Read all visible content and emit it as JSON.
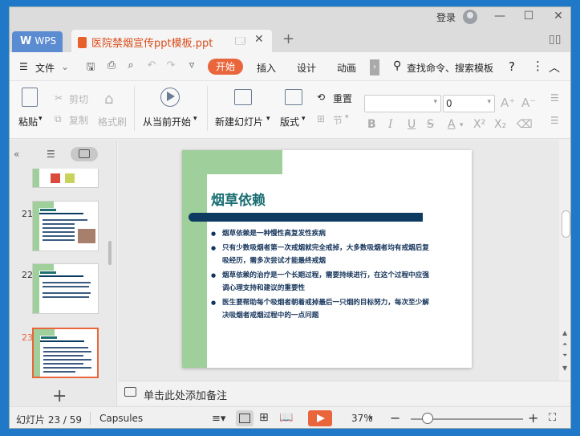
{
  "titlebar": {
    "login": "登录"
  },
  "tabs": {
    "wps": "WPS",
    "wps_logo": "W",
    "document": "医院禁烟宣传ppt模板.ppt"
  },
  "menu": {
    "file": "文件",
    "items": [
      "开始",
      "插入",
      "设计",
      "动画"
    ],
    "search": "查找命令、搜索模板",
    "help": "?"
  },
  "ribbon": {
    "paste": "粘贴",
    "cut": "剪切",
    "copy": "复制",
    "format_painter": "格式刷",
    "play_from_current": "从当前开始",
    "new_slide": "新建幻灯片",
    "layout": "版式",
    "reset": "重置",
    "section": "节",
    "font_size": "0"
  },
  "left_panel": {
    "thumbnails": [
      {
        "number": "21"
      },
      {
        "number": "22"
      },
      {
        "number": "23"
      }
    ],
    "add": "+"
  },
  "slide": {
    "title": "烟草依赖",
    "bullets": [
      "烟草依赖是一种慢性高复发性疾病",
      "只有少数吸烟者第一次戒烟就完全戒掉，大多数吸烟者均有戒烟后复吸经历，需多次尝试才能最终戒烟",
      "烟草依赖的治疗是一个长期过程，需要持续进行，在这个过程中应强调心理支持和建议的重要性",
      "医生要帮助每个吸烟者朝着戒掉最后一只烟的目标努力，每次至少解决吸烟者戒烟过程中的一点问题"
    ]
  },
  "notes": {
    "placeholder": "单击此处添加备注"
  },
  "status": {
    "slide_count": "幻灯片 23 / 59",
    "theme": "Capsules",
    "zoom": "37%",
    "zoom_level": 37
  },
  "colors": {
    "accent": "#e9663c",
    "slide_green": "#9fcf9a",
    "slide_title": "#1a6e72",
    "slide_bar": "#0d3a61"
  }
}
